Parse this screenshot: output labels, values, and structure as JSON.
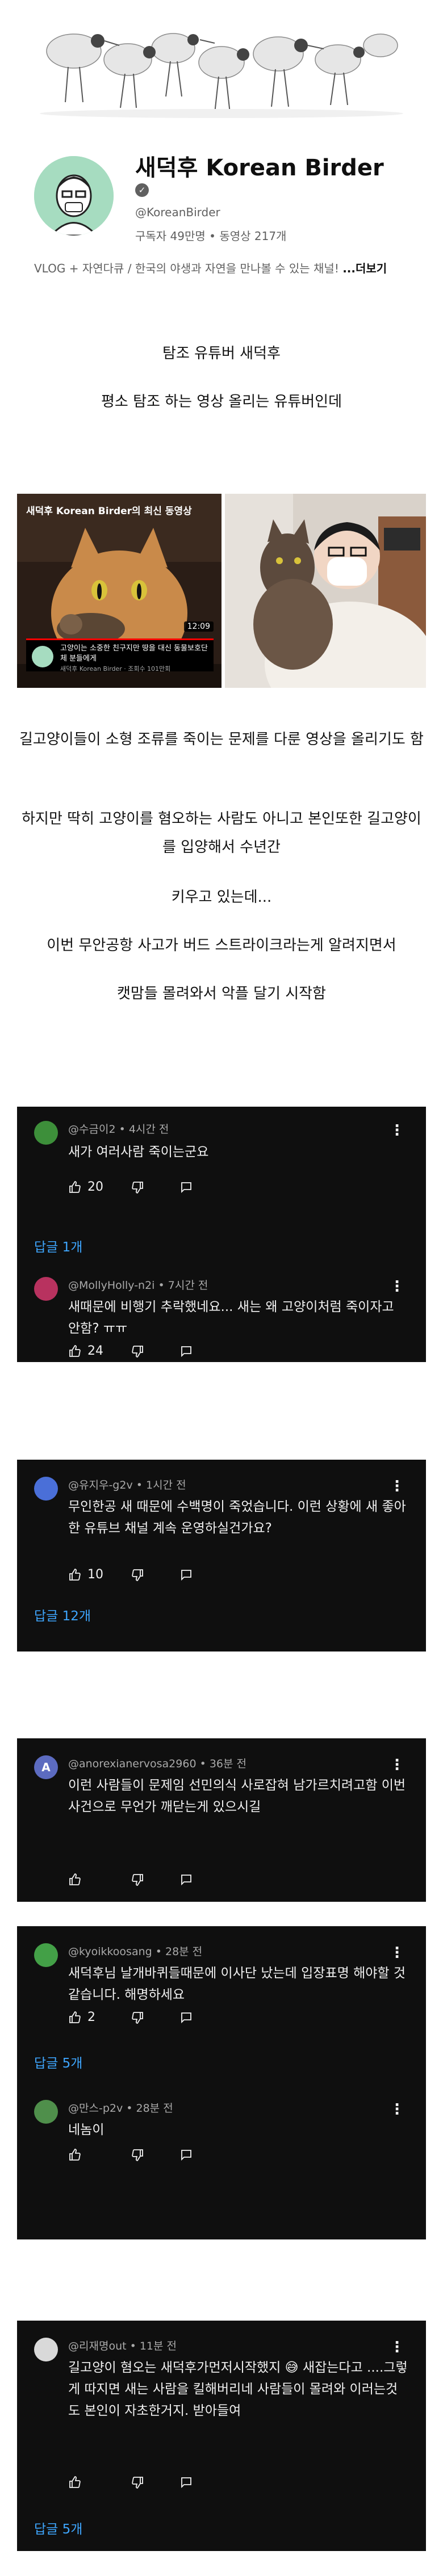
{
  "channel": {
    "name": "새덕후 Korean Birder",
    "verified_icon": "check-circle-icon",
    "handle": "@KoreanBirder",
    "stats": "구독자 49만명 • 동영상 217개",
    "description": "VLOG + 자연다큐 / 한국의 야생과 자연을 만나볼 수 있는 채널! ",
    "more_label": "...더보기"
  },
  "post": {
    "paragraphs": [
      "탐조 유튜버 새덕후",
      "평소 탐조 하는 영상 올리는 유튜버인데",
      "길고양이들이 소형 조류를 죽이는 문제를 다룬 영상을 올리기도 함",
      "하지만 딱히 고양이를 혐오하는 사람도 아니고 본인또한 길고양이를 입양해서 수년간",
      "키우고 있는데...",
      "이번 무안공항 사고가 버드 스트라이크라는게 알려지면서",
      "캣맘들 몰려와서 악플 달기 시작함"
    ]
  },
  "videos": {
    "left_title": "새덕후 Korean Birder의 최신 동영상",
    "duration": "12:09",
    "caption_title": "고양이는 소중한 친구지만 땅을 대신 동물보호단체 분들에게",
    "caption_meta": "새덕후 Korean Birder · 조회수 101만회"
  },
  "icons": {
    "like": "thumbs-up-icon",
    "dislike": "thumbs-down-icon",
    "reply": "reply-icon",
    "more": "more-vertical-icon"
  },
  "comments": [
    {
      "author": "@수금이2 • 4시간 전",
      "avatar_letter": "",
      "avatar_color": "#3d8f3a",
      "text": "새가 여러사람 죽이는군요",
      "likes": "20",
      "replies": "답글 1개"
    },
    {
      "author": "@MollyHolly-n2i • 7시간 전",
      "avatar_letter": "",
      "avatar_color": "#b8325f",
      "text": "새때문에 비행기 추락했네요... 새는 왜 고양이처럼 죽이자고 안함? ㅠㅠ",
      "likes": "24",
      "replies": ""
    },
    {
      "author": "@유지우-g2v • 1시간 전",
      "avatar_letter": "",
      "avatar_color": "#4a6fd8",
      "text": "무인한공 새 때문에 수백명이 죽었습니다. 이런 상황에 새 좋아한 유튜브 채널 계속 운영하실건가요?",
      "likes": "10",
      "replies": "답글 12개"
    },
    {
      "author": "@anorexianervosa2960 • 36분 전",
      "avatar_letter": "A",
      "avatar_color": "#5c6bc0",
      "text": "이런 사람들이 문제임 선민의식 사로잡혀 남가르치려고함 이번 사건으로 무언가 깨닫는게 있으시길",
      "likes": "",
      "replies": ""
    },
    {
      "author": "@kyoikkoosang • 28분 전",
      "avatar_letter": "",
      "avatar_color": "#43a047",
      "text": "새덕후님 날개바퀴들때문에 이사단 났는데 입장표명 해야할 것 같습니다. 해명하세요",
      "likes": "2",
      "replies": "답글 5개"
    },
    {
      "author": "@만스-p2v • 28분 전",
      "avatar_letter": "",
      "avatar_color": "#4f8f4b",
      "text": "네놈이",
      "likes": "",
      "replies": ""
    },
    {
      "author": "@리재명out • 11분 전",
      "avatar_letter": "",
      "avatar_color": "#d9d9d9",
      "text": "길고양이 혐오는 새덕후가먼저시작했지 😅 새잡는다고 ....그렇게 따지면 새는 사람을 킬해버리네 사람들이 몰려와 이러는것도 본인이 자초한거지. 받아들여",
      "likes": "",
      "replies": "답글 5개"
    }
  ]
}
